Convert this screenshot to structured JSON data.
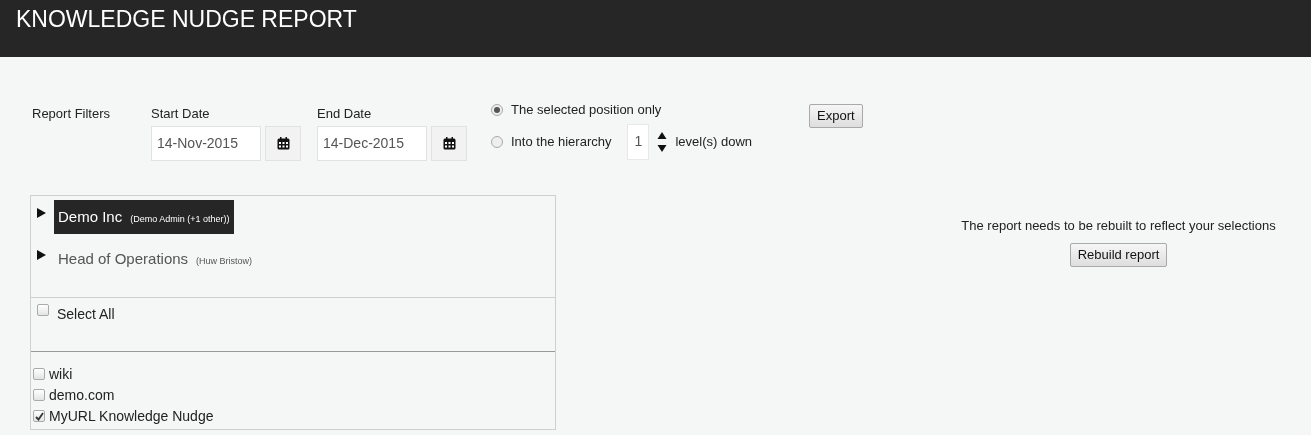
{
  "header": {
    "title": "KNOWLEDGE NUDGE REPORT"
  },
  "filters": {
    "label": "Report Filters",
    "start_date": {
      "label": "Start Date",
      "value": "14-Nov-2015"
    },
    "end_date": {
      "label": "End Date",
      "value": "14-Dec-2015"
    },
    "scope_options": [
      {
        "label": "The selected position only",
        "selected": true
      },
      {
        "label": "Into the hierarchy",
        "selected": false
      }
    ],
    "levels": {
      "value": "1",
      "suffix": "level(s) down"
    },
    "export_button": "Export"
  },
  "tree": {
    "nodes": [
      {
        "name": "Demo Inc",
        "holder": "(Demo Admin (+1 other))",
        "selected": true,
        "expanded": false
      },
      {
        "name": "Head of Operations",
        "holder": "(Huw Bristow)",
        "selected": false,
        "expanded": false
      }
    ]
  },
  "select_all": {
    "label": "Select All",
    "checked": false
  },
  "sources": [
    {
      "label": "wiki",
      "checked": false
    },
    {
      "label": "demo.com",
      "checked": false
    },
    {
      "label": "MyURL Knowledge Nudge",
      "checked": true
    }
  ],
  "rebuild": {
    "message": "The report needs to be rebuilt to reflect your selections",
    "button": "Rebuild report"
  }
}
